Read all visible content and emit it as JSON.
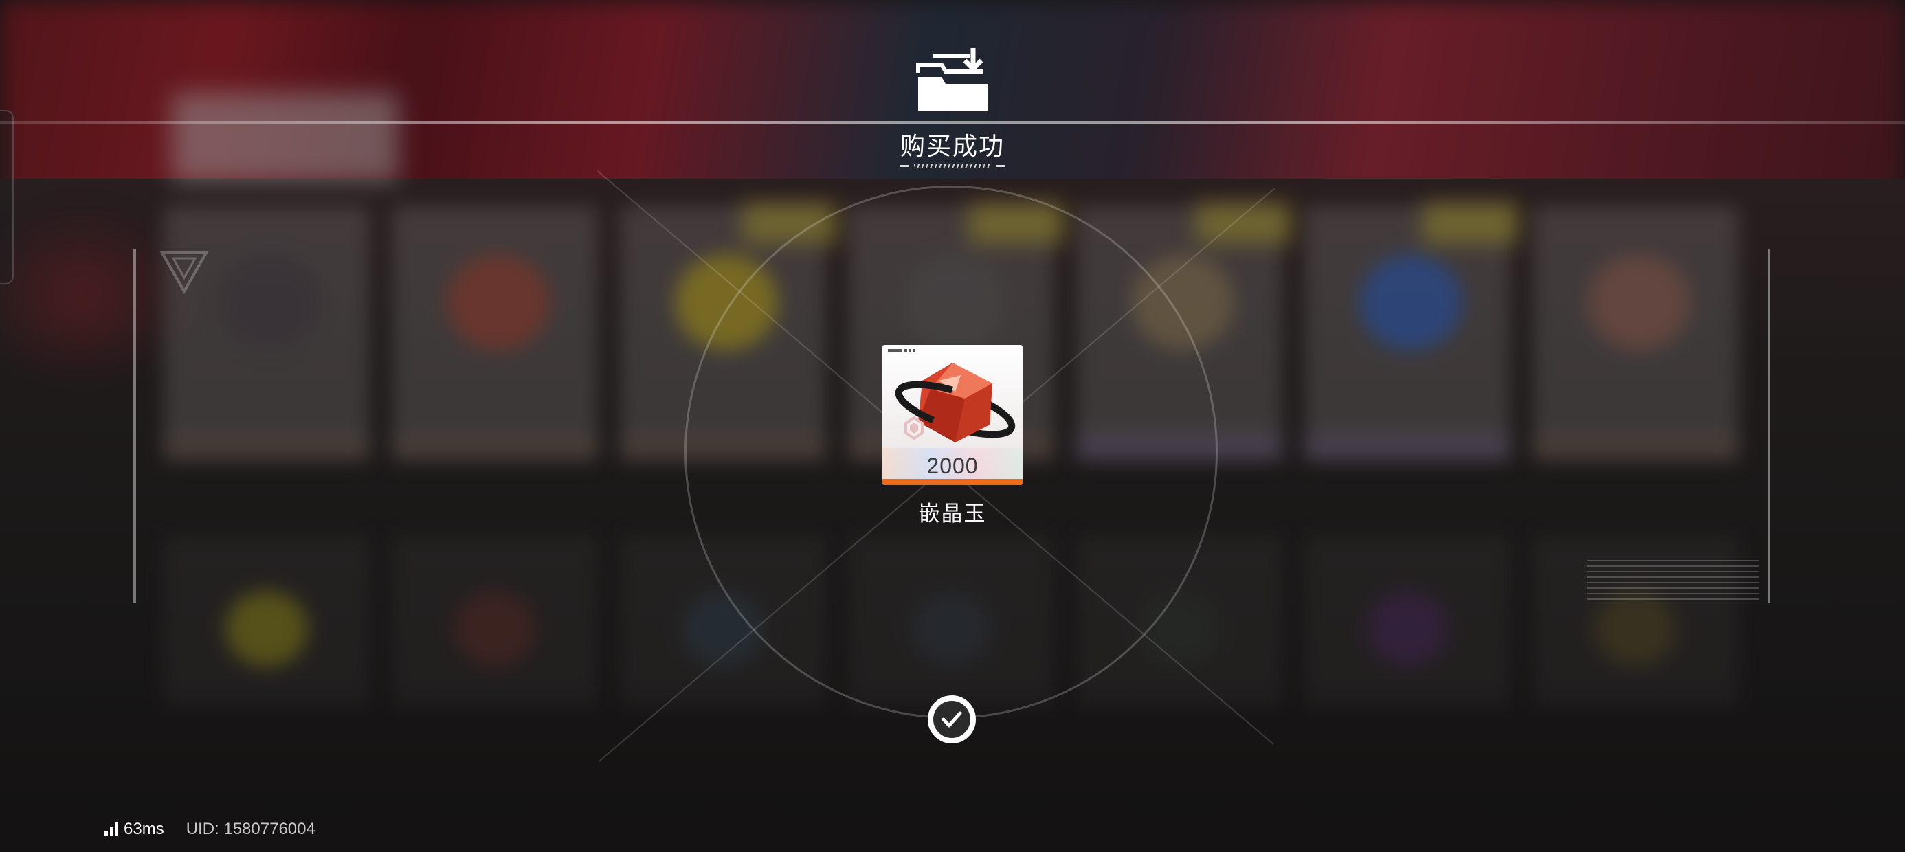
{
  "dialog": {
    "title": "购买成功",
    "header_icon": "inbox-tray-check-icon",
    "confirm_icon": "checkmark-icon"
  },
  "reward": {
    "item_name": "嵌晶玉",
    "quantity": "2000",
    "icon": "red-crystal-icon",
    "rarity_color": "#EE6A1F"
  },
  "footer": {
    "signal_icon": "signal-bars-icon",
    "ping": "63ms",
    "uid": "UID: 1580776004"
  },
  "colors": {
    "background": "#1C1B1B",
    "accent_red": "#A3202C",
    "text_primary": "#FFFFFF",
    "text_secondary": "#C9C9C9"
  }
}
